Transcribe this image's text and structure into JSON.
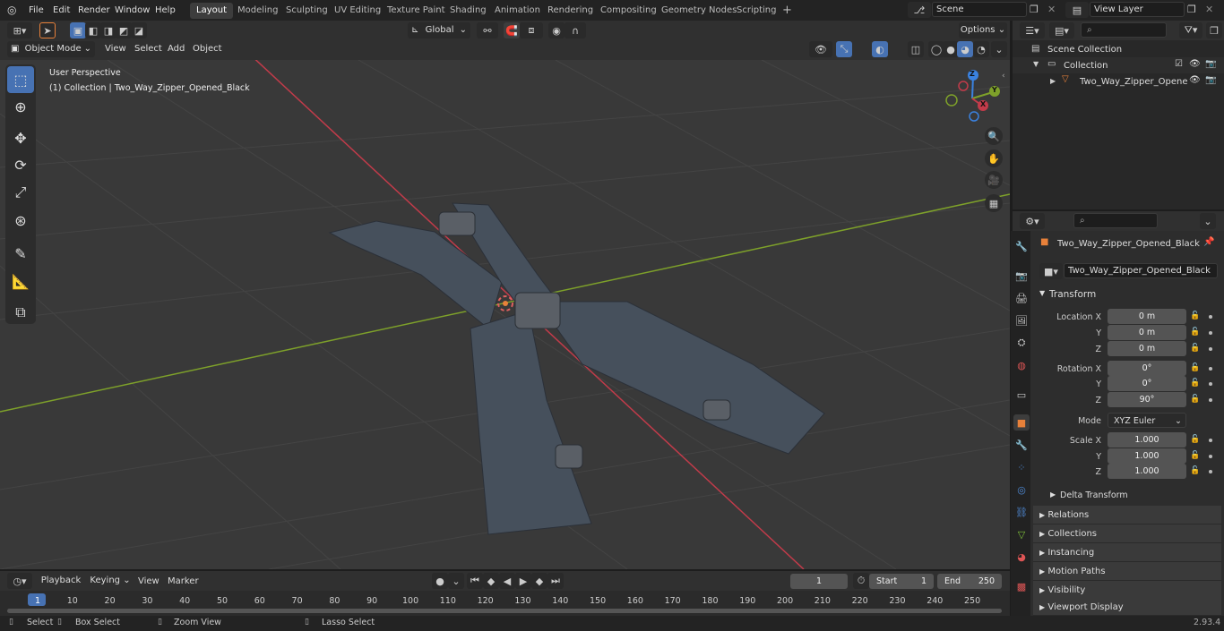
{
  "topbar": {
    "menus": [
      "File",
      "Edit",
      "Render",
      "Window",
      "Help"
    ],
    "workspaces": [
      "Layout",
      "Modeling",
      "Sculpting",
      "UV Editing",
      "Texture Paint",
      "Shading",
      "Animation",
      "Rendering",
      "Compositing",
      "Geometry Nodes",
      "Scripting"
    ],
    "add_tab": "+",
    "scene": "Scene",
    "view_layer": "View Layer"
  },
  "viewport": {
    "mode": "Object Mode",
    "menus": [
      "View",
      "Select",
      "Add",
      "Object"
    ],
    "transform_orientation": "Global",
    "options": "Options",
    "overlay_title": "User Perspective",
    "overlay_subtitle": "(1) Collection | Two_Way_Zipper_Opened_Black",
    "gizmo": {
      "x": "X",
      "y": "Y",
      "z": "Z"
    }
  },
  "outliner": {
    "scene_collection": "Scene Collection",
    "collection": "Collection",
    "object": "Two_Way_Zipper_Opene"
  },
  "properties": {
    "object_name": "Two_Way_Zipper_Opened_Black",
    "data_name": "Two_Way_Zipper_Opened_Black",
    "transform_header": "Transform",
    "location_label": "Location X",
    "rotation_label": "Rotation X",
    "scale_label": "Scale X",
    "y_label": "Y",
    "z_label": "Z",
    "location": [
      "0 m",
      "0 m",
      "0 m"
    ],
    "rotation": [
      "0°",
      "0°",
      "90°"
    ],
    "mode_label": "Mode",
    "mode_value": "XYZ Euler",
    "scale": [
      "1.000",
      "1.000",
      "1.000"
    ],
    "delta_transform": "Delta Transform",
    "panels": [
      "Relations",
      "Collections",
      "Instancing",
      "Motion Paths",
      "Visibility",
      "Viewport Display"
    ]
  },
  "timeline": {
    "menus": [
      "Playback",
      "Keying",
      "View",
      "Marker"
    ],
    "current_frame": "1",
    "start_label": "Start",
    "start_value": "1",
    "end_label": "End",
    "end_value": "250",
    "ticks": [
      "1",
      "10",
      "20",
      "30",
      "40",
      "50",
      "60",
      "70",
      "80",
      "90",
      "100",
      "110",
      "120",
      "130",
      "140",
      "150",
      "160",
      "170",
      "180",
      "190",
      "200",
      "210",
      "220",
      "230",
      "240",
      "250"
    ]
  },
  "statusbar": {
    "select": "Select",
    "box_select": "Box Select",
    "zoom_view": "Zoom View",
    "lasso_select": "Lasso Select",
    "version": "2.93.4"
  },
  "colors": {
    "accent": "#4772b3",
    "x_axis": "#c23b4a",
    "y_axis": "#7ea12a",
    "object": "#e8813a"
  }
}
